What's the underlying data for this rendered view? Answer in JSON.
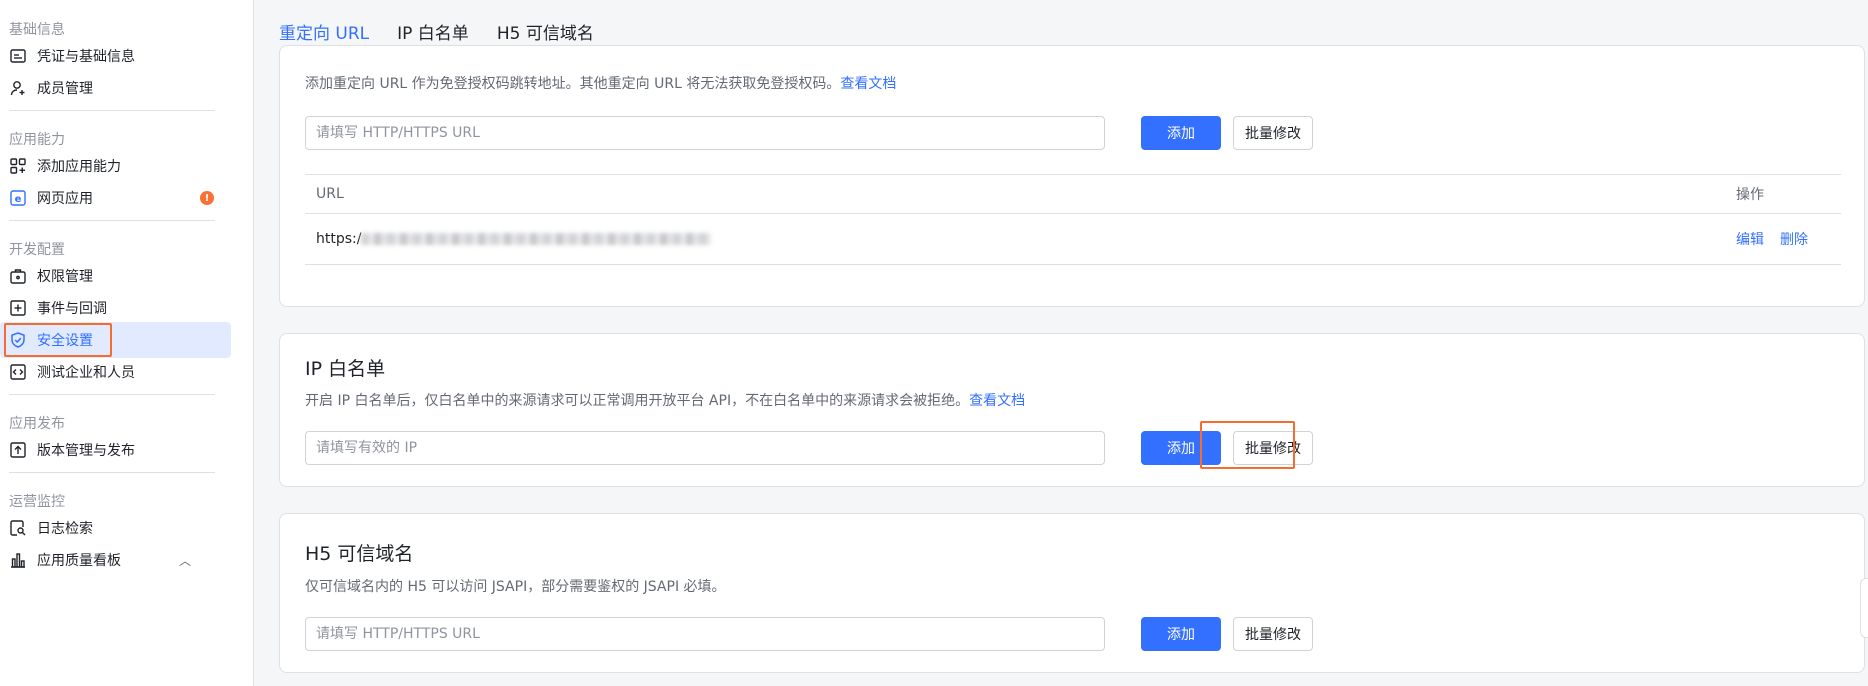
{
  "sidebar": {
    "groups": {
      "basic": "基础信息",
      "ability": "应用能力",
      "dev": "开发配置",
      "release": "应用发布",
      "ops": "运营监控"
    },
    "items": {
      "credentials": "凭证与基础信息",
      "members": "成员管理",
      "add_ability": "添加应用能力",
      "web_app": "网页应用",
      "permissions": "权限管理",
      "events": "事件与回调",
      "security": "安全设置",
      "test_enterprise": "测试企业和人员",
      "versions": "版本管理与发布",
      "log_search": "日志检索",
      "quality_board": "应用质量看板"
    },
    "web_app_badge": "!",
    "accent_color": "#3370ff",
    "highlight_color": "#f56c2d"
  },
  "tabs": [
    "重定向 URL",
    "IP 白名单",
    "H5 可信域名"
  ],
  "redirect": {
    "desc": "添加重定向 URL 作为免登授权码跳转地址。其他重定向 URL 将无法获取免登授权码。",
    "doc_link": "查看文档",
    "placeholder": "请填写 HTTP/HTTPS URL",
    "add_label": "添加",
    "batch_label": "批量修改",
    "table": {
      "col_url": "URL",
      "col_action": "操作",
      "rows": [
        {
          "url_prefix": "https:/",
          "edit": "编辑",
          "delete": "删除"
        }
      ]
    }
  },
  "ip_whitelist": {
    "title": "IP 白名单",
    "desc": "开启 IP 白名单后，仅白名单中的来源请求可以正常调用开放平台 API，不在白名单中的来源请求会被拒绝。",
    "doc_link": "查看文档",
    "placeholder": "请填写有效的 IP",
    "add_label": "添加",
    "batch_label": "批量修改"
  },
  "h5_domain": {
    "title": "H5 可信域名",
    "desc": "仅可信域名内的 H5 可以访问 JSAPI，部分需要鉴权的 JSAPI 必填。",
    "placeholder": "请填写 HTTP/HTTPS URL",
    "add_label": "添加",
    "batch_label": "批量修改"
  }
}
